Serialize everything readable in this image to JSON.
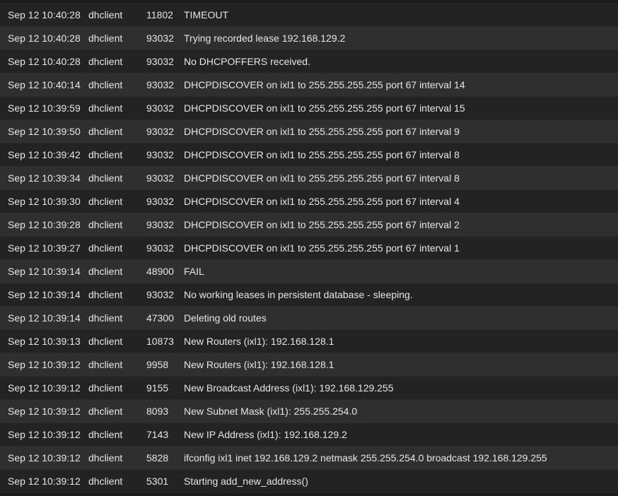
{
  "log": {
    "rows": [
      {
        "time": "Sep 12 10:40:28",
        "process": "dhclient",
        "pid": "11802",
        "message": "TIMEOUT"
      },
      {
        "time": "Sep 12 10:40:28",
        "process": "dhclient",
        "pid": "93032",
        "message": "Trying recorded lease 192.168.129.2"
      },
      {
        "time": "Sep 12 10:40:28",
        "process": "dhclient",
        "pid": "93032",
        "message": "No DHCPOFFERS received."
      },
      {
        "time": "Sep 12 10:40:14",
        "process": "dhclient",
        "pid": "93032",
        "message": "DHCPDISCOVER on ixl1 to 255.255.255.255 port 67 interval 14"
      },
      {
        "time": "Sep 12 10:39:59",
        "process": "dhclient",
        "pid": "93032",
        "message": "DHCPDISCOVER on ixl1 to 255.255.255.255 port 67 interval 15"
      },
      {
        "time": "Sep 12 10:39:50",
        "process": "dhclient",
        "pid": "93032",
        "message": "DHCPDISCOVER on ixl1 to 255.255.255.255 port 67 interval 9"
      },
      {
        "time": "Sep 12 10:39:42",
        "process": "dhclient",
        "pid": "93032",
        "message": "DHCPDISCOVER on ixl1 to 255.255.255.255 port 67 interval 8"
      },
      {
        "time": "Sep 12 10:39:34",
        "process": "dhclient",
        "pid": "93032",
        "message": "DHCPDISCOVER on ixl1 to 255.255.255.255 port 67 interval 8"
      },
      {
        "time": "Sep 12 10:39:30",
        "process": "dhclient",
        "pid": "93032",
        "message": "DHCPDISCOVER on ixl1 to 255.255.255.255 port 67 interval 4"
      },
      {
        "time": "Sep 12 10:39:28",
        "process": "dhclient",
        "pid": "93032",
        "message": "DHCPDISCOVER on ixl1 to 255.255.255.255 port 67 interval 2"
      },
      {
        "time": "Sep 12 10:39:27",
        "process": "dhclient",
        "pid": "93032",
        "message": "DHCPDISCOVER on ixl1 to 255.255.255.255 port 67 interval 1"
      },
      {
        "time": "Sep 12 10:39:14",
        "process": "dhclient",
        "pid": "48900",
        "message": "FAIL"
      },
      {
        "time": "Sep 12 10:39:14",
        "process": "dhclient",
        "pid": "93032",
        "message": "No working leases in persistent database - sleeping."
      },
      {
        "time": "Sep 12 10:39:14",
        "process": "dhclient",
        "pid": "47300",
        "message": "Deleting old routes"
      },
      {
        "time": "Sep 12 10:39:13",
        "process": "dhclient",
        "pid": "10873",
        "message": "New Routers (ixl1): 192.168.128.1"
      },
      {
        "time": "Sep 12 10:39:12",
        "process": "dhclient",
        "pid": "9958",
        "message": "New Routers (ixl1): 192.168.128.1"
      },
      {
        "time": "Sep 12 10:39:12",
        "process": "dhclient",
        "pid": "9155",
        "message": "New Broadcast Address (ixl1): 192.168.129.255"
      },
      {
        "time": "Sep 12 10:39:12",
        "process": "dhclient",
        "pid": "8093",
        "message": "New Subnet Mask (ixl1): 255.255.254.0"
      },
      {
        "time": "Sep 12 10:39:12",
        "process": "dhclient",
        "pid": "7143",
        "message": "New IP Address (ixl1): 192.168.129.2"
      },
      {
        "time": "Sep 12 10:39:12",
        "process": "dhclient",
        "pid": "5828",
        "message": "ifconfig ixl1 inet 192.168.129.2 netmask 255.255.254.0 broadcast 192.168.129.255"
      },
      {
        "time": "Sep 12 10:39:12",
        "process": "dhclient",
        "pid": "5301",
        "message": "Starting add_new_address()"
      }
    ]
  },
  "colors": {
    "row_odd": "#232323",
    "row_even": "#2f2f2f",
    "text": "#e6e6e6"
  }
}
